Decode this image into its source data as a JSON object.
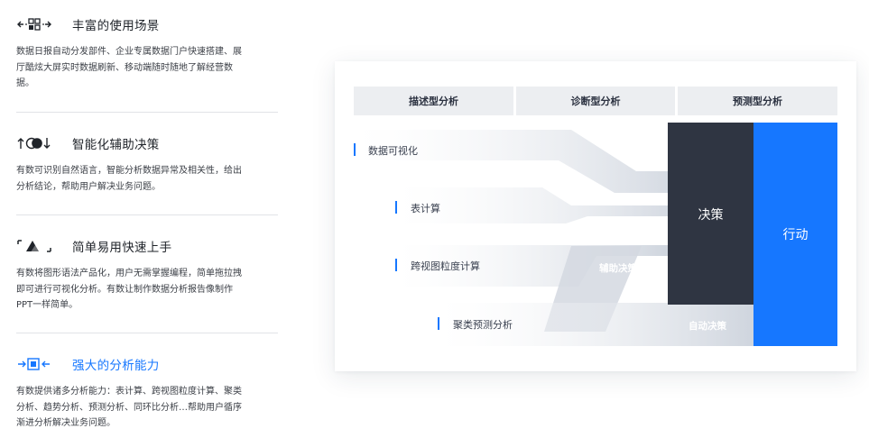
{
  "features": [
    {
      "title": "丰富的使用场景",
      "icon": "grid-arrows-icon",
      "desc": "数据日报自动分发部件、企业专属数据门户快速搭建、展厅酷炫大屏实时数据刷新、移动端随时随地了解经营数据。",
      "active": false
    },
    {
      "title": "智能化辅助决策",
      "icon": "toggle-arrows-icon",
      "desc": "有数可识别自然语言，智能分析数据异常及相关性，给出分析结论，帮助用户解决业务问题。",
      "active": false
    },
    {
      "title": "简单易用快速上手",
      "icon": "bracket-triangle-icon",
      "desc": "有数将图形语法产品化，用户无需掌握编程，简单拖拉拽即可进行可视化分析。有数让制作数据分析报告像制作PPT一样简单。",
      "active": false
    },
    {
      "title": "强大的分析能力",
      "icon": "focus-square-icon",
      "desc": "有数提供诸多分析能力：表计算、跨视图粒度计算、聚类分析、趋势分析、预测分析、同环比分析…帮助用户循序渐进分析解决业务问题。",
      "active": true
    }
  ],
  "diagram": {
    "headers": [
      "描述型分析",
      "诊断型分析",
      "预测型分析"
    ],
    "rows": [
      "数据可视化",
      "表计算",
      "跨视图粒度计算",
      "聚类预测分析"
    ],
    "decision": "决策",
    "action": "行动",
    "assist": "辅助决策",
    "auto": "自动决策",
    "colors": {
      "accent": "#1677ff",
      "dark": "#2f3542",
      "band": "#dfe3ea"
    }
  }
}
